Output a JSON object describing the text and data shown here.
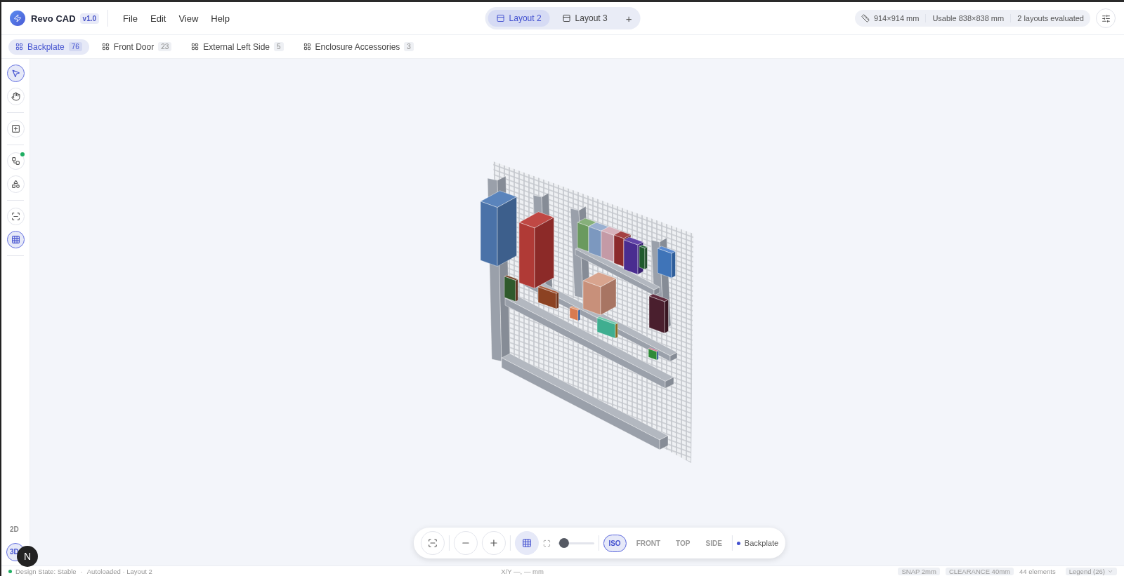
{
  "app": {
    "name": "Revo CAD",
    "version": "v1.0"
  },
  "menu": [
    "File",
    "Edit",
    "View",
    "Help"
  ],
  "layouts": [
    {
      "label": "Layout 2",
      "selected": true
    },
    {
      "label": "Layout 3",
      "selected": false
    }
  ],
  "add_layout": "+",
  "summary": {
    "size": "914×914 mm",
    "usable": "Usable 838×838 mm",
    "evaluated": "2 layouts evaluated"
  },
  "panels": [
    {
      "label": "Backplate",
      "count": "76",
      "selected": true
    },
    {
      "label": "Front Door",
      "count": "23",
      "selected": false
    },
    {
      "label": "External Left Side",
      "count": "5",
      "selected": false
    },
    {
      "label": "Enclosure Accessories",
      "count": "3",
      "selected": false
    }
  ],
  "tool_groups": [
    [
      {
        "kind": "select",
        "selected": true,
        "dot": false
      },
      {
        "kind": "pan",
        "selected": false,
        "dot": false
      }
    ],
    [
      {
        "kind": "add",
        "selected": false,
        "dot": false
      }
    ],
    [
      {
        "kind": "tree",
        "selected": false,
        "dot": true
      },
      {
        "kind": "components",
        "selected": false,
        "dot": false
      }
    ],
    [
      {
        "kind": "fit",
        "selected": false,
        "dot": false
      },
      {
        "kind": "grid",
        "selected": true,
        "dot": false
      }
    ]
  ],
  "view_modes": [
    {
      "label": "2D",
      "selected": false
    },
    {
      "label": "3D",
      "selected": true
    }
  ],
  "dev_badge": "N",
  "viewport_toolbar": {
    "grid_on": true,
    "zoom": {
      "level": 0.05
    },
    "views": [
      {
        "label": "ISO",
        "selected": true
      },
      {
        "label": "FRONT",
        "selected": false
      },
      {
        "label": "TOP",
        "selected": false
      },
      {
        "label": "SIDE",
        "selected": false
      }
    ],
    "layer": "Backplate"
  },
  "status": {
    "state": "Design State: Stable",
    "separator": "·",
    "source": "Autoloaded · Layout 2",
    "coords": "X/Y —, — mm",
    "snap": "SNAP 2mm",
    "clearance": "CLEARANCE 40mm",
    "elements": "44 elements",
    "legend": "Legend (26)"
  }
}
